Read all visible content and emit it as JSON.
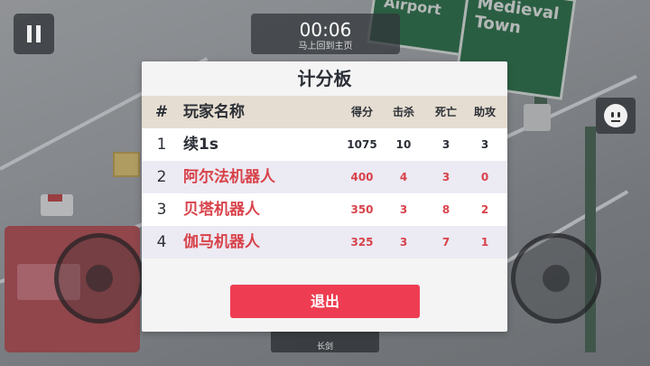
{
  "hud": {
    "timer": "00:06",
    "timer_subtitle": "马上回到主页",
    "weapon_label": "长剑",
    "sign_left": "Airport",
    "sign_right": "Medieval Town"
  },
  "scoreboard": {
    "title": "计分板",
    "headers": {
      "rank": "#",
      "name": "玩家名称",
      "score": "得分",
      "kills": "击杀",
      "deaths": "死亡",
      "assists": "助攻"
    },
    "rows": [
      {
        "rank": "1",
        "name": "续1s",
        "score": "1075",
        "kills": "10",
        "deaths": "3",
        "assists": "3",
        "type": "player"
      },
      {
        "rank": "2",
        "name": "阿尔法机器人",
        "score": "400",
        "kills": "4",
        "deaths": "3",
        "assists": "0",
        "type": "bot"
      },
      {
        "rank": "3",
        "name": "贝塔机器人",
        "score": "350",
        "kills": "3",
        "deaths": "8",
        "assists": "2",
        "type": "bot"
      },
      {
        "rank": "4",
        "name": "伽马机器人",
        "score": "325",
        "kills": "3",
        "deaths": "7",
        "assists": "1",
        "type": "bot"
      }
    ],
    "exit_label": "退出"
  },
  "colors": {
    "accent": "#ee3d52",
    "bot_text": "#d8434b",
    "header_bg": "#e5ddd1"
  },
  "icons": {
    "pause": "pause-icon",
    "emote": "face-icon",
    "crosshair": "crosshair-icon",
    "move": "shoe-icon"
  }
}
